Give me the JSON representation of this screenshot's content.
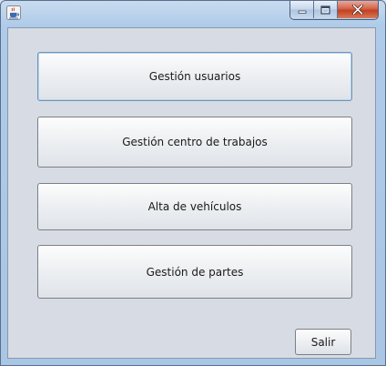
{
  "window": {
    "title": "",
    "controls": {
      "minimize_icon": "minimize-icon",
      "maximize_icon": "maximize-icon",
      "close_icon": "close-icon"
    },
    "app_icon": "java-cup-icon"
  },
  "menu_buttons": [
    {
      "label": "Gestión usuarios"
    },
    {
      "label": "Gestión centro de trabajos"
    },
    {
      "label": "Alta de vehículos"
    },
    {
      "label": "Gestión de partes"
    }
  ],
  "exit_button": {
    "label": "Salir"
  },
  "colors": {
    "frame": "#aecbe9",
    "panel": "#d7dce4",
    "close_button": "#c2401f"
  }
}
